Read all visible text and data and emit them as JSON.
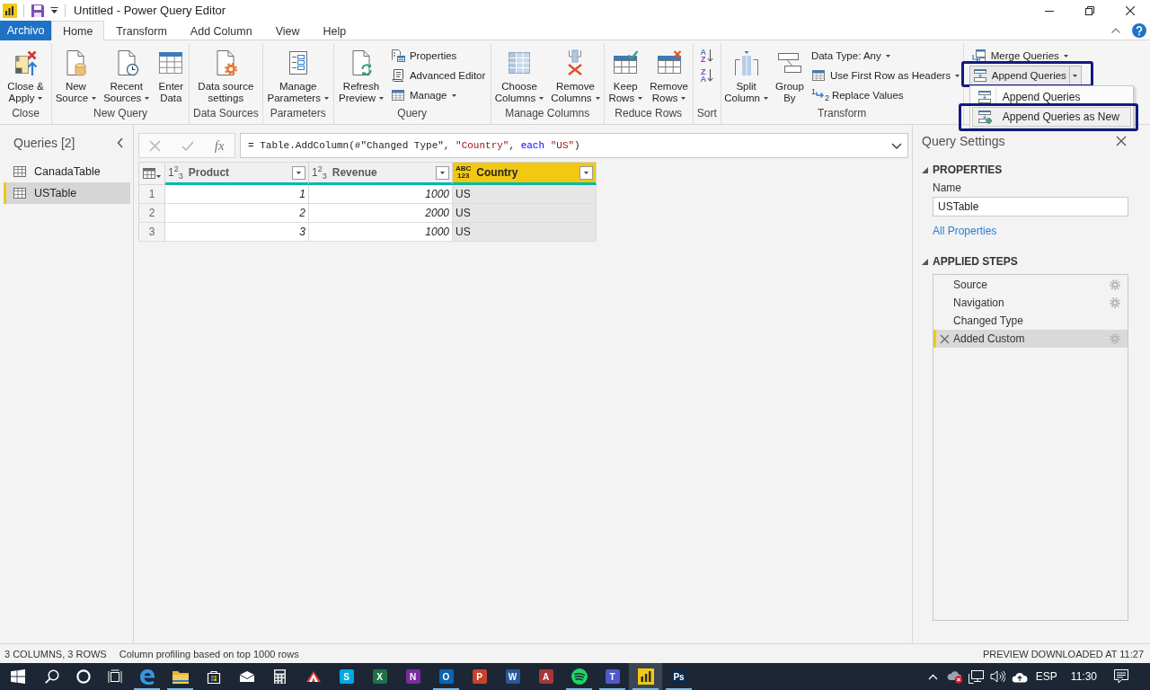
{
  "title_bar": {
    "title": "Untitled - Power Query Editor"
  },
  "tabs": [
    {
      "label": "Archivo",
      "kind": "file",
      "selected": false
    },
    {
      "label": "Home",
      "kind": "tab",
      "selected": true
    },
    {
      "label": "Transform",
      "kind": "tab",
      "selected": false
    },
    {
      "label": "Add Column",
      "kind": "tab",
      "selected": false
    },
    {
      "label": "View",
      "kind": "tab",
      "selected": false
    },
    {
      "label": "Help",
      "kind": "tab",
      "selected": false
    }
  ],
  "ribbon": {
    "groups": [
      {
        "label": "Close",
        "items": [
          {
            "kind": "large",
            "lines": [
              "Close &",
              "Apply"
            ],
            "dropdown": true
          }
        ]
      },
      {
        "label": "New Query",
        "items": [
          {
            "kind": "large",
            "lines": [
              "New",
              "Source"
            ],
            "dropdown": true
          },
          {
            "kind": "large",
            "lines": [
              "Recent",
              "Sources"
            ],
            "dropdown": true
          },
          {
            "kind": "large",
            "lines": [
              "Enter",
              "Data"
            ],
            "dropdown": false
          }
        ]
      },
      {
        "label": "Data Sources",
        "items": [
          {
            "kind": "large",
            "lines": [
              "Data source",
              "settings"
            ],
            "dropdown": false
          }
        ]
      },
      {
        "label": "Parameters",
        "items": [
          {
            "kind": "large",
            "lines": [
              "Manage",
              "Parameters"
            ],
            "dropdown": true
          }
        ]
      },
      {
        "label": "Query",
        "items": [
          {
            "kind": "large",
            "lines": [
              "Refresh",
              "Preview"
            ],
            "dropdown": true
          },
          {
            "kind": "small",
            "label": "Properties",
            "dropdown": false
          },
          {
            "kind": "small",
            "label": "Advanced Editor",
            "dropdown": false
          },
          {
            "kind": "small",
            "label": "Manage",
            "dropdown": true
          }
        ]
      },
      {
        "label": "Manage Columns",
        "items": [
          {
            "kind": "large",
            "lines": [
              "Choose",
              "Columns"
            ],
            "dropdown": true
          },
          {
            "kind": "large",
            "lines": [
              "Remove",
              "Columns"
            ],
            "dropdown": true
          }
        ]
      },
      {
        "label": "Reduce Rows",
        "items": [
          {
            "kind": "large",
            "lines": [
              "Keep",
              "Rows"
            ],
            "dropdown": true
          },
          {
            "kind": "large",
            "lines": [
              "Remove",
              "Rows"
            ],
            "dropdown": true
          }
        ]
      },
      {
        "label": "Sort",
        "items": [
          {
            "kind": "sort",
            "letters": [
              {
                "text": "A",
                "color": "#3b7dd8"
              },
              {
                "text": "Z",
                "color": "#8b49b8"
              }
            ]
          },
          {
            "kind": "sort",
            "letters": [
              {
                "text": "Z",
                "color": "#8b49b8"
              },
              {
                "text": "A",
                "color": "#3b7dd8"
              }
            ]
          }
        ]
      },
      {
        "label": "Transform",
        "items": [
          {
            "kind": "large",
            "lines": [
              "Split",
              "Column"
            ],
            "dropdown": true
          },
          {
            "kind": "large",
            "lines": [
              "Group",
              "By"
            ],
            "dropdown": false
          },
          {
            "kind": "small",
            "label": "Data Type: Any",
            "dropdown": true
          },
          {
            "kind": "small",
            "label": "Use First Row as Headers",
            "dropdown": true
          },
          {
            "kind": "small",
            "label": "Replace Values",
            "dropdown": false,
            "icon_text": [
              "1",
              "2"
            ]
          }
        ]
      },
      {
        "items": [
          {
            "kind": "small",
            "label": "Merge Queries",
            "dropdown": true
          },
          {
            "kind": "split",
            "label": "Append Queries",
            "expanded": true,
            "annotated": true,
            "menu": [
              {
                "label": "Append Queries",
                "selected": false,
                "annotated": false
              },
              {
                "label": "Append Queries as New",
                "selected": true,
                "annotated": true
              }
            ]
          }
        ]
      }
    ]
  },
  "queries": {
    "title": "Queries [2]",
    "items": [
      {
        "label": "CanadaTable",
        "selected": false
      },
      {
        "label": "USTable",
        "selected": true
      }
    ]
  },
  "formula_bar": {
    "fx": "fx",
    "formula": [
      {
        "text": "= Table.AddColumn(#\"Changed Type\", ",
        "kind": "plain"
      },
      {
        "text": "\"Country\"",
        "kind": "string"
      },
      {
        "text": ", ",
        "kind": "plain"
      },
      {
        "text": "each",
        "kind": "keyword"
      },
      {
        "text": " \"US\"",
        "kind": "string"
      },
      {
        "text": ")",
        "kind": "plain"
      }
    ]
  },
  "table": {
    "columns": [
      {
        "name": "Product",
        "kind": "number",
        "type_lines": [
          "1$^{2}$$_{3}$"
        ],
        "selected": false
      },
      {
        "name": "Revenue",
        "kind": "number",
        "type_lines": [
          "1$^{2}$$_{3}$"
        ],
        "selected": false
      },
      {
        "name": "Country",
        "kind": "text",
        "type_lines": [
          "ABC",
          "123"
        ],
        "selected": true
      }
    ],
    "rows": [
      {
        "number": "1",
        "cells": [
          "1",
          "1000",
          "US"
        ]
      },
      {
        "number": "2",
        "cells": [
          "2",
          "2000",
          "US"
        ]
      },
      {
        "number": "3",
        "cells": [
          "3",
          "1000",
          "US"
        ]
      }
    ]
  },
  "query_settings": {
    "title": "Query Settings",
    "properties": {
      "heading": "PROPERTIES",
      "expanded": true,
      "name_label": "Name",
      "name_value": "USTable",
      "link": "All Properties"
    },
    "applied_steps": {
      "heading": "APPLIED STEPS",
      "expanded": true,
      "steps": [
        {
          "label": "Source",
          "settings": true,
          "selected": false
        },
        {
          "label": "Navigation",
          "settings": true,
          "selected": false
        },
        {
          "label": "Changed Type",
          "settings": false,
          "selected": false
        },
        {
          "label": "Added Custom",
          "settings": true,
          "selected": true
        }
      ]
    }
  },
  "status_bar": {
    "left": [
      "3 COLUMNS, 3 ROWS",
      "Column profiling based on top 1000 rows"
    ],
    "right": "PREVIEW DOWNLOADED AT 11:27"
  },
  "taskbar": {
    "apps": [
      {
        "open": true,
        "active": false
      },
      {
        "open": true,
        "active": false
      },
      {
        "open": false,
        "active": false
      },
      {
        "open": false,
        "active": false
      },
      {
        "open": false,
        "active": false
      },
      {
        "open": false,
        "active": false
      },
      {
        "letter": "S",
        "color": "#00a9e6",
        "open": false,
        "active": false
      },
      {
        "letter": "X",
        "color": "#1e7145",
        "open": false,
        "active": false
      },
      {
        "letter": "N",
        "color": "#7b2b9e",
        "open": false,
        "active": false
      },
      {
        "letter": "O",
        "color": "#0a64b4",
        "open": true,
        "active": false
      },
      {
        "letter": "P",
        "color": "#c8432b",
        "open": false,
        "active": false
      },
      {
        "letter": "W",
        "color": "#2b5797",
        "open": false,
        "active": false
      },
      {
        "letter": "A",
        "color": "#a4373a",
        "open": false,
        "active": false
      },
      {
        "open": true,
        "active": false
      },
      {
        "letter": "T",
        "color": "#5059c9",
        "open": true,
        "active": false
      },
      {
        "open": true,
        "active": true
      },
      {
        "letter": "Ps",
        "color": "#0b2a4a",
        "open": true,
        "active": false
      }
    ],
    "tray": {
      "language": "ESP",
      "time": "11:30"
    }
  }
}
